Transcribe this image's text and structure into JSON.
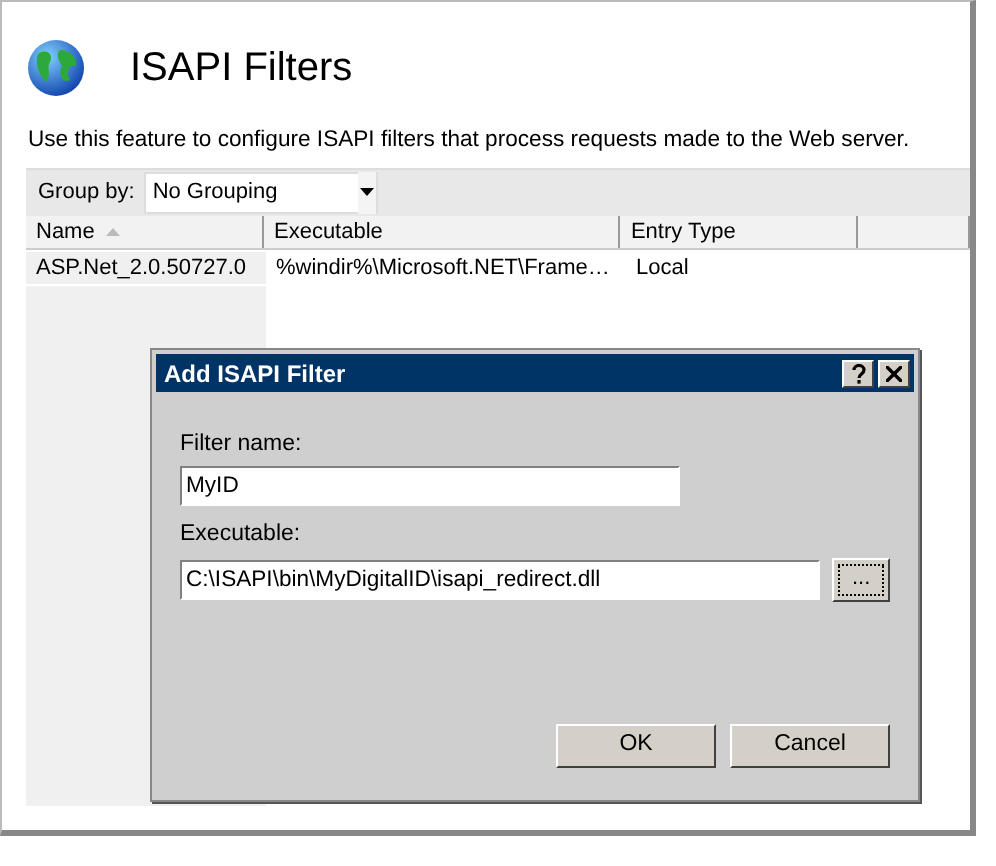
{
  "header": {
    "title": "ISAPI Filters",
    "description": "Use this feature to configure ISAPI filters that process requests made to the Web server."
  },
  "toolbar": {
    "label": "Group by:",
    "value": "No Grouping"
  },
  "table": {
    "columns": [
      {
        "label": "Name",
        "sorted": true
      },
      {
        "label": "Executable",
        "sorted": false
      },
      {
        "label": "Entry Type",
        "sorted": false
      }
    ],
    "rows": [
      {
        "cells": [
          "ASP.Net_2.0.50727.0",
          "%windir%\\Microsoft.NET\\Frame…",
          "Local"
        ],
        "selected": false
      }
    ]
  },
  "dialog": {
    "title": "Add ISAPI Filter",
    "fields": [
      {
        "label": "Filter name:",
        "value": "MyID",
        "browse": false
      },
      {
        "label": "Executable:",
        "value": "C:\\ISAPI\\bin\\MyDigitalID\\isapi_redirect.dll",
        "browse": true,
        "browse_label": "..."
      }
    ],
    "buttons": [
      "OK",
      "Cancel"
    ]
  }
}
